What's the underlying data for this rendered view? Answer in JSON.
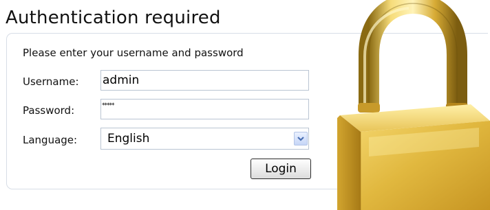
{
  "page": {
    "title": "Authentication required"
  },
  "form": {
    "instruction": "Please enter your username and password",
    "username_label": "Username:",
    "username_value": "admin",
    "password_label": "Password:",
    "password_value": "*****",
    "language_label": "Language:",
    "language_selected": "English",
    "login_label": "Login"
  },
  "icons": {
    "select_arrow": "chevron-down-icon",
    "lock": "padlock-icon"
  },
  "colors": {
    "box_border": "#d7dde6",
    "input_border": "#b9c4d2",
    "lock_gold": "#e8c04a"
  }
}
